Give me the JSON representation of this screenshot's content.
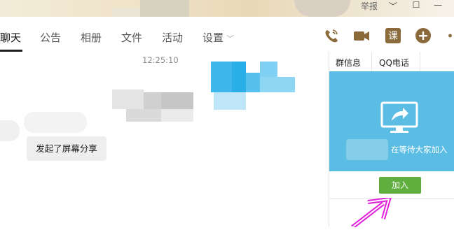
{
  "window": {
    "header_text": "举报",
    "minimize": "﹀",
    "maximize": "☐",
    "close": "—"
  },
  "nav": {
    "tabs": [
      {
        "label": "聊天",
        "active": true
      },
      {
        "label": "公告"
      },
      {
        "label": "相册"
      },
      {
        "label": "文件"
      },
      {
        "label": "活动"
      },
      {
        "label": "设置",
        "has_dropdown": true
      }
    ],
    "tools": [
      "phone-icon",
      "video-call-icon",
      "course-icon",
      "plus-circle-icon",
      "more-icon"
    ],
    "course_glyph": "课"
  },
  "chat": {
    "timestamp": "12:25:10",
    "message_text": "发起了屏幕分享"
  },
  "side": {
    "tabs": [
      {
        "label": "群信息"
      },
      {
        "label": "QQ电话"
      }
    ],
    "waiting_text": "在等待大家加入",
    "join_label": "加入",
    "panel_color": "#5cbde4",
    "join_color": "#5fae3e",
    "arrow_color": "#e020d8"
  }
}
